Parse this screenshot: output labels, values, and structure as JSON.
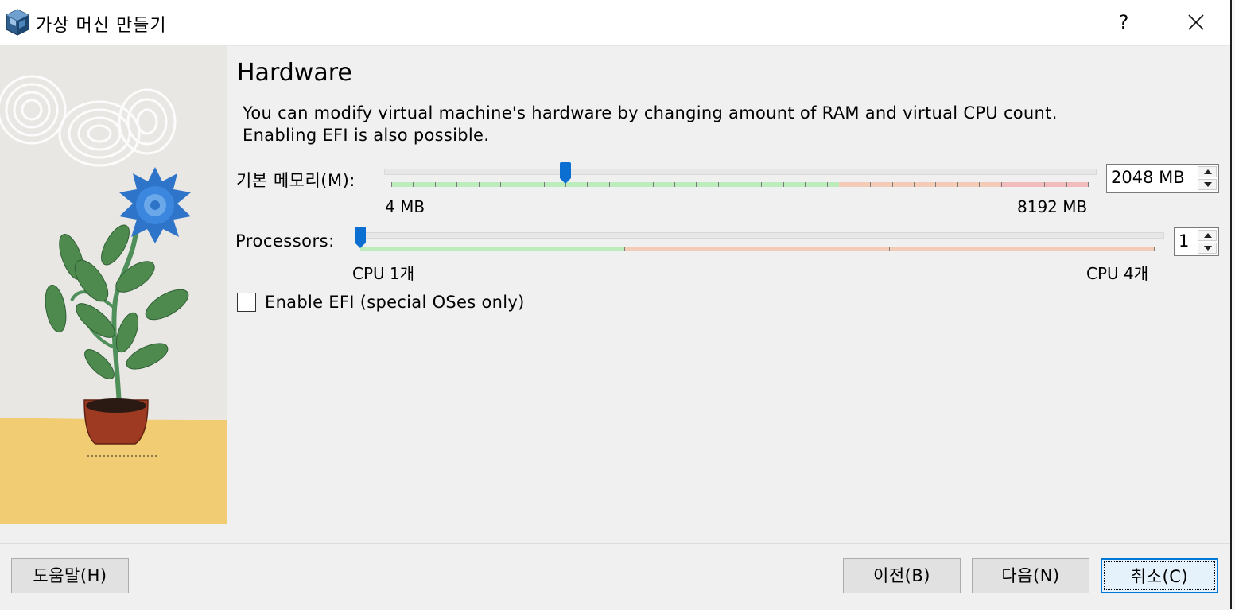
{
  "window": {
    "title": "가상 머신 만들기",
    "help_label": "?",
    "app_icon": "virtualbox-icon",
    "close_icon": "close-icon"
  },
  "page": {
    "heading": "Hardware",
    "description_line1": "You can modify virtual machine's hardware by changing amount of RAM and virtual CPU count.",
    "description_line2": "Enabling EFI is also possible."
  },
  "memory": {
    "label": "기본 메모리(M):",
    "min_label": "4 MB",
    "max_label": "8192 MB",
    "value_display": "2048 MB",
    "value": 2048,
    "min": 4,
    "max": 8192
  },
  "processors": {
    "label": "Processors:",
    "min_label": "CPU 1개",
    "max_label": "CPU 4개",
    "value_display": "1",
    "value": 1,
    "min": 1,
    "max": 4
  },
  "efi": {
    "label": "Enable EFI (special OSes only)",
    "checked": false
  },
  "buttons": {
    "help": "도움말(H)",
    "back": "이전(B)",
    "next": "다음(N)",
    "cancel": "취소(C)"
  },
  "colors": {
    "zone_green": "#bcebbc",
    "zone_orange": "#f4cbb6",
    "zone_red": "#f1bcbc",
    "thumb_blue": "#0a6fd1",
    "default_button_border": "#0078d7"
  }
}
